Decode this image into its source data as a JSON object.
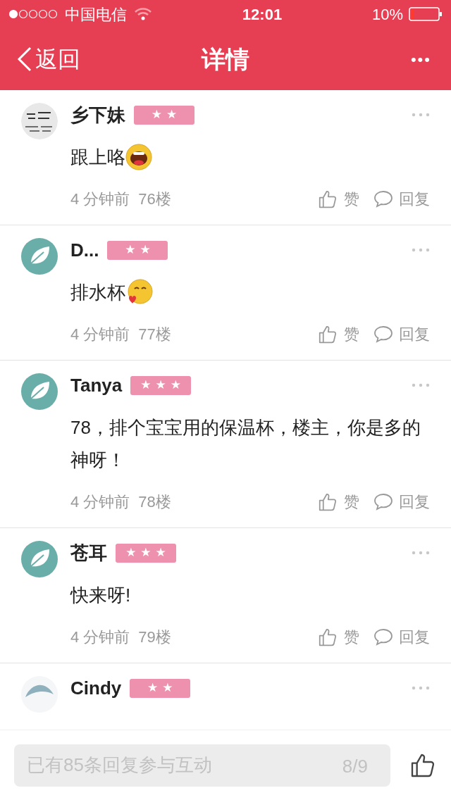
{
  "status_bar": {
    "carrier": "中国电信",
    "time": "12:01",
    "battery": "10%"
  },
  "nav": {
    "back": "返回",
    "title": "详情",
    "more": "•••"
  },
  "comments": [
    {
      "name": "乡下妹",
      "badge": "★★",
      "text": "跟上咯",
      "emoji": {
        "kind": "laugh"
      },
      "time": "4 分钟前",
      "floor": "76楼",
      "like": "赞",
      "reply": "回复"
    },
    {
      "name": "D...",
      "badge": "★★",
      "avatar": {
        "kind": "leaf"
      },
      "text": "排水杯",
      "emoji": {
        "kind": "kiss"
      },
      "time": "4 分钟前",
      "floor": "77楼",
      "like": "赞",
      "reply": "回复"
    },
    {
      "name": "Tanya",
      "badge": "★★★",
      "avatar": {
        "kind": "leaf"
      },
      "text": "78，排个宝宝用的保温杯，楼主，你是多的神呀！",
      "time": "4 分钟前",
      "floor": "78楼",
      "like": "赞",
      "reply": "回复"
    },
    {
      "name": "苍耳",
      "badge": "★★★",
      "avatar": {
        "kind": "leaf"
      },
      "text": "快来呀!",
      "time": "4 分钟前",
      "floor": "79楼",
      "like": "赞",
      "reply": "回复"
    },
    {
      "name": "Cindy",
      "badge": "★★",
      "avatar": {
        "kind": "feather"
      }
    }
  ],
  "bottom_bar": {
    "placeholder": "已有85条回复参与互动",
    "page": "8/9"
  }
}
